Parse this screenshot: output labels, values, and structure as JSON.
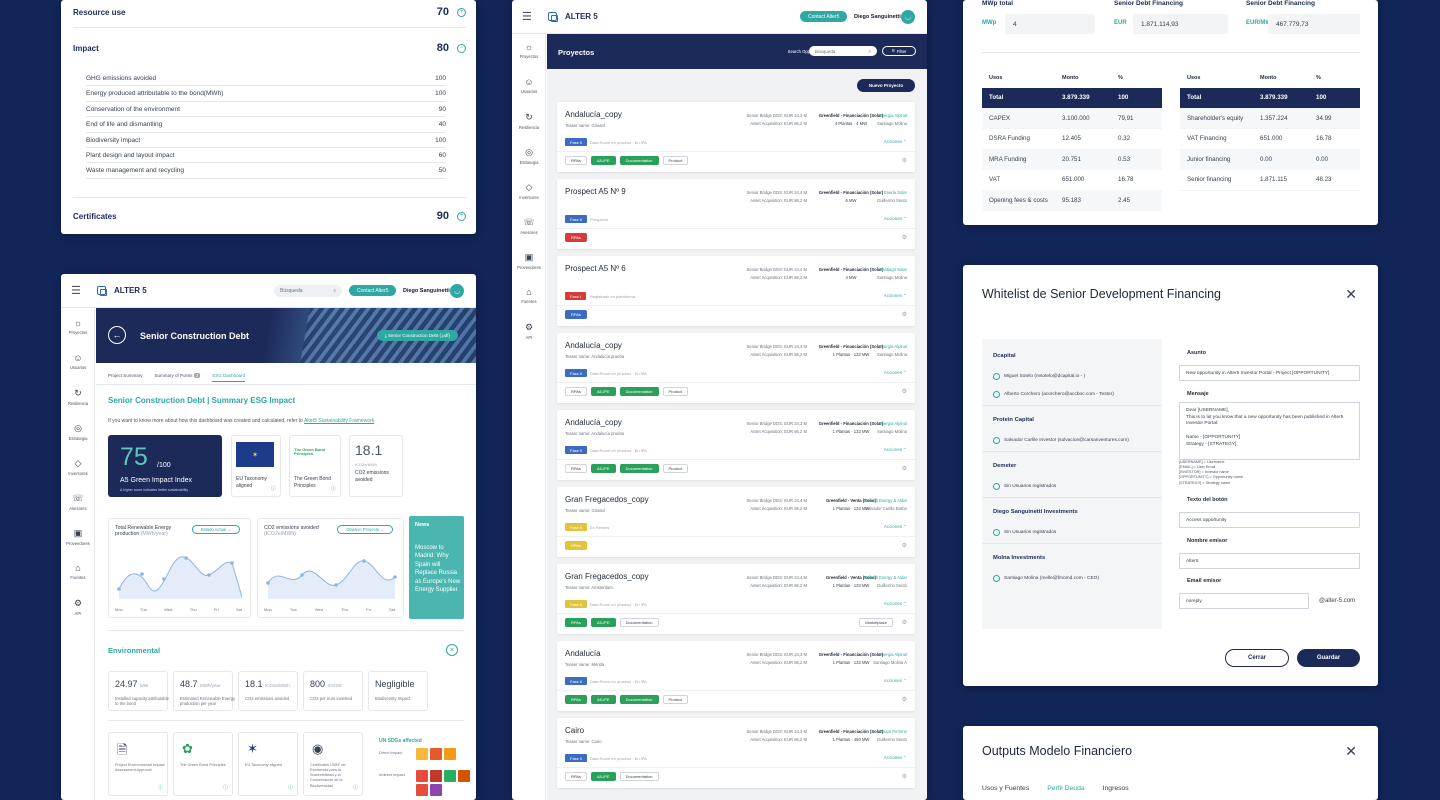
{
  "scores": {
    "resource_use": {
      "label": "Resource use",
      "value": "70"
    },
    "impact": {
      "label": "Impact",
      "value": "80"
    },
    "impact_items": [
      {
        "label": "GHG emissions avoided",
        "value": "100"
      },
      {
        "label": "Energy produced attributable to the bond(MWh)",
        "value": "100"
      },
      {
        "label": "Conservation of the environment",
        "value": "90"
      },
      {
        "label": "End of life and dismantling",
        "value": "40"
      },
      {
        "label": "Biodiversity impact",
        "value": "100"
      },
      {
        "label": "Plant design and layout impact",
        "value": "60"
      },
      {
        "label": "Waste management and recycling",
        "value": "50"
      }
    ],
    "certificates": {
      "label": "Certificates",
      "value": "90"
    }
  },
  "app": {
    "brand": "ALTER 5",
    "search_placeholder": "Búsqueda",
    "contact_label": "Contact Alter5",
    "user_name": "Diego Sanguinetti",
    "nav": [
      "Proyectos",
      "Usuarios",
      "Resiliencia",
      "Estrategia",
      "Inversores",
      "Asesores",
      "Proveedores",
      "Fuentes",
      "API"
    ]
  },
  "dashboard": {
    "hero_title": "Senior Construction Debt",
    "hero_pill": "Senior Construction Debt (.pdf)",
    "tabs": [
      "Project Summary",
      "Summary of Points",
      "ESG Dashboard"
    ],
    "tab_badge": "3",
    "title": "Senior Construction Debt | Summary ESG Impact",
    "intro": "If you want to know more about how this dashboard was created and calculated, refer to",
    "intro_link": "Alter5 Sustainability Framework",
    "index_value": "75",
    "index_max": "/100",
    "index_label": "A5 Green Impact Index",
    "index_note": "A higher score indicates better sustainability",
    "k2_label": "EU Taxonomy aligned",
    "k3_label": "The Green Bond Principles",
    "k3_logo": "The Green Bond Principles",
    "k4_value": "18.1",
    "k4_unit": "tCO2e/MWh",
    "k4_label": "CO2 emissions avoided",
    "chart1": {
      "title": "Total Renewable Energy production",
      "unit": "(MWh/year)",
      "select": "Estado Actual"
    },
    "chart2": {
      "title": "CO2 emissions avoided",
      "unit": "(tCO2e/MWh)",
      "select": "Objetivo Proyecto"
    },
    "days": [
      "Mon",
      "Tue",
      "Wed",
      "Thu",
      "Fri",
      "Sat"
    ],
    "news_title": "News",
    "news_text": "Moscow to Madrid: Why Spain will Replace Russia as Europe's New Energy Supplier",
    "env_title": "Environmental",
    "env": [
      {
        "value": "24.97",
        "unit": "MW",
        "label": "Installed capacity attributable to the bond"
      },
      {
        "value": "48.7",
        "unit": "MWh/year",
        "label": "Estimated Renewable Energy production per year"
      },
      {
        "value": "18.1",
        "unit": "tCO2e/MWh",
        "label": "CO2 emissions avoided"
      },
      {
        "value": "800",
        "unit": "tCO2/€",
        "label": "CO2 per euro invested"
      },
      {
        "value": "Negligible",
        "unit": "",
        "label": "Biodiversity Impact"
      }
    ],
    "docs": [
      "Project Environmental Impact Assessment Approval",
      "The Green Bond Principles",
      "EU Taxonomy aligned",
      "Certificates UNEF de Excelencia para la Sostenibilidad y la Conservación de la Biodiversidad"
    ],
    "sdg_title": "UN SDGs affected",
    "sdg_direct": "Direct impact",
    "sdg_indirect": "Indirect impact"
  },
  "projects_page": {
    "title": "Proyectos",
    "search_label": "Search Opportunities",
    "search_placeholder": "Búsqueda",
    "filter_label": "Filter",
    "new_label": "Nuevo Proyecto",
    "actions_label": "Acciones",
    "projects": [
      {
        "name": "Andalucía_copy",
        "sub": "Teaser name: Girasol",
        "m1a": "Senior Bridge DDS: EUR 24,3 M",
        "m1b": "Asset Acquisition: EUR 86,2 M",
        "m2a": "Greenfield - Financiación (Solar)",
        "m2b": "4 Plantas · 4 MW",
        "tag": "Energía Alpinal",
        "owner": "Santiago Molina",
        "phase": "Fase II",
        "phase_color": "blue",
        "note": "Data Room en proceso · En IPA",
        "chips": [
          [
            "RPAs",
            ""
          ],
          [
            "A5-IPE",
            "green"
          ],
          [
            "Documentation",
            "green"
          ],
          [
            "Product",
            ""
          ]
        ]
      },
      {
        "name": "Prospect A5 Nº 9",
        "sub": "",
        "m1a": "Senior Bridge DDS: EUR 24,4 M",
        "m1b": "Asset Acquisition: EUR 86,2 M",
        "m2a": "Greenfield - Financiación (Solar)",
        "m2b": "6 MW",
        "tag": "Enerla Solar",
        "owner": "Guillermo Seuto",
        "phase": "Fase II",
        "phase_color": "blue",
        "note": "Prospecto",
        "chips": [
          [
            "RPAs",
            "red"
          ]
        ]
      },
      {
        "name": "Prospect A5 Nº 6",
        "sub": "",
        "m1a": "Senior Bridge DDS: EUR 24,4 M",
        "m1b": "Asset Acquisition: EUR 86,2 M",
        "m2a": "Greenfield - Financiación (Solar)",
        "m2b": "4 MW",
        "tag": "Santiago Solar",
        "owner": "Santiago Molina",
        "phase": "Fase I",
        "phase_color": "red",
        "note": "Registrado en plataforma",
        "chips": [
          [
            "RPAs",
            "blue"
          ]
        ]
      },
      {
        "name": "Andalucía_copy",
        "sub": "Teaser name: Andalucía prueba",
        "m1a": "Senior Bridge DDS: EUR 24,3 M",
        "m1b": "Asset Acquisition: EUR 86,2 M",
        "m2a": "Greenfield - Financiación (Solar)",
        "m2b": "1 Plantas · 133 MW",
        "tag": "Energía Alpinal",
        "owner": "Santiago Molina",
        "phase": "Fase II",
        "phase_color": "blue",
        "note": "Data Room en proceso · En IPA",
        "chips": [
          [
            "RPAs",
            ""
          ],
          [
            "A5-IPE",
            "green"
          ],
          [
            "Documentation",
            "green"
          ],
          [
            "Product",
            ""
          ]
        ]
      },
      {
        "name": "Andalucía_copy",
        "sub": "Teaser name: Andalucía prueba",
        "m1a": "Senior Bridge DDS: EUR 24,3 M",
        "m1b": "Asset Acquisition: EUR 86,2 M",
        "m2a": "Greenfield - Financiación (Solar)",
        "m2b": "1 Plantas · 133 MW",
        "tag": "Energía Alpinal",
        "owner": "Santiago Molina",
        "phase": "Fase II",
        "phase_color": "blue",
        "note": "Data Room en proceso · En IPA",
        "chips": [
          [
            "RPAs",
            ""
          ],
          [
            "A5-IPE",
            "green"
          ],
          [
            "Documentation",
            "green"
          ],
          [
            "Product",
            ""
          ]
        ]
      },
      {
        "name": "Gran Fregacedos_copy",
        "sub": "Teaser name: Girasol",
        "m1a": "Senior Bridge DDS: EUR 24,4 M",
        "m1b": "Asset Acquisition: EUR 86,2 M",
        "m2a": "Greenfield - Venta (Solar)",
        "m2b": "1 Plantas · 133 MW",
        "tag": "Fotovelt Energy & Aldar",
        "owner": "Salvador Carlile Barbo",
        "phase": "Fase II",
        "phase_color": "yellow",
        "note": "En Review",
        "chips": [
          [
            "RPAs",
            "yellow"
          ]
        ]
      },
      {
        "name": "Gran Fregacedos_copy",
        "sub": "Teaser name: Amsterdam",
        "m1a": "Senior Bridge DDS: EUR 24,4 M",
        "m1b": "Asset Acquisition: EUR 86,2 M",
        "m2a": "Greenfield - Venta (Solar)",
        "m2b": "1 Plantas · 133 MW",
        "tag": "Fotovelt Energy & Aldar",
        "owner": "Guillermo Seuto",
        "phase": "Fase II",
        "phase_color": "yellow",
        "note": "Data Room en proceso · En IPA",
        "chips": [
          [
            "RPAs",
            "green"
          ],
          [
            "A5-IPE",
            "green"
          ],
          [
            "Documentation",
            ""
          ]
        ],
        "market": "Marketplace"
      },
      {
        "name": "Andalucía",
        "sub": "Teaser name: Mérida",
        "m1a": "Senior Bridge DDS: EUR 24,3 M",
        "m1b": "Asset Acquisition: EUR 86,2 M",
        "m2a": "Greenfield - Financiación (Solar)",
        "m2b": "1 Plantas · 133 MW",
        "tag": "Energía Alpinal",
        "owner": "Santiago Molina A",
        "phase": "Fase II",
        "phase_color": "blue",
        "note": "Data Room en proceso · En IPA",
        "chips": [
          [
            "RPAs",
            "green"
          ],
          [
            "A5-IPE",
            "green"
          ],
          [
            "Documentation",
            "green"
          ],
          [
            "Product",
            ""
          ]
        ]
      },
      {
        "name": "Cairo",
        "sub": "Teaser name: Cairo",
        "m1a": "Senior Bridge DDS: EUR 24,3 M",
        "m1b": "Asset Acquisition: EUR 86,2 M",
        "m2a": "Greenfield - Financiación (Solar)",
        "m2b": "1 Plantas · 450 MW",
        "tag": "Grupo Pertone",
        "owner": "Guillermo Seuto",
        "phase": "Fase II",
        "phase_color": "blue",
        "note": "Data Room en proceso · En IPA",
        "chips": [
          [
            "RPAs",
            ""
          ],
          [
            "A5-IPE",
            "green"
          ],
          [
            "Documentation",
            ""
          ]
        ]
      }
    ]
  },
  "financing": {
    "h1": "MWp total",
    "h2": "Senior Debt Financing",
    "h3": "Senior Debt Financing",
    "l1": "MWp",
    "v1": "4",
    "l2": "EUR",
    "v2": "1.871.114,93",
    "l3": "EUR/MW",
    "v3": "467.779,73",
    "headers": [
      "Usos",
      "Monto",
      "%"
    ],
    "usos": [
      [
        "Total",
        "3.879.339",
        "100"
      ],
      [
        "CAPEX",
        "3.100.000",
        "79,91"
      ],
      [
        "DSRA Funding",
        "12.405",
        "0.32"
      ],
      [
        "MRA Funding",
        "20.751",
        "0.53"
      ],
      [
        "VAT",
        "651.000",
        "16.78"
      ],
      [
        "Opening fees & costs",
        "95.183",
        "2.45"
      ]
    ],
    "fuentes": [
      [
        "Total",
        "3.879.339",
        "100"
      ],
      [
        "Shareholder's equity",
        "1.357.224",
        "34.99"
      ],
      [
        "VAT Financing",
        "651.000",
        "16.78"
      ],
      [
        "Junior financing",
        "0.00",
        "0.00"
      ],
      [
        "Senior financing",
        "1.871.115",
        "48.23"
      ]
    ]
  },
  "whitelist": {
    "title": "Whitelist de Senior Development Financing",
    "groups": [
      {
        "name": "Dcapital",
        "items": [
          "Miguel Sotelo (msotelo@dcapital.io - )",
          "Alberto Corchero (acorchero@accboc.com - Tester)"
        ]
      },
      {
        "name": "Protein Capital",
        "items": [
          "Salvador Carlile Investor (sulvacion@carsanventures.com)"
        ]
      },
      {
        "name": "Demeter",
        "items": [
          "Sin Usuarios registrados"
        ]
      },
      {
        "name": "Diego Sanguinetti Investments",
        "items": [
          "Sin Usuarios registrados"
        ]
      },
      {
        "name": "Molna Investments",
        "items": [
          "Santiago Molina (melle@fmomd.com - CEO)"
        ]
      }
    ],
    "asunto_label": "Asunto",
    "asunto_value": "New opportunity in Alter5 Investor Portal - Project [OPPORTUNITY]",
    "mensaje_label": "Mensaje",
    "mensaje_value": "Dear [USERNAME],\nThis is to let you know that a new opportunity has been published in Alter5 Investor Portal:\n\nName - [OPPORTUNITY]\nStrategy - [STRATEGY]",
    "vars": "[USERNAME] = Username\n[EMAIL] = User Email\n[INVESTOR] = Investor name\n[OPPORTUNITY] = Opportunity name\n[STRATEGY] = Strategy name",
    "boton_label": "Texto del botón",
    "boton_value": "Access opportunity",
    "emisor_label": "Nombre emisor",
    "emisor_value": "Alter5",
    "email_label": "Email emisor",
    "email_value": "noreply",
    "email_domain": "@alter-5.com",
    "cancel_label": "Cerrar",
    "save_label": "Guardar"
  },
  "outputs": {
    "title": "Outputs Modelo Financiero",
    "tabs": [
      "Usos y Fuentes",
      "Perfil Deuda",
      "Ingresos"
    ]
  }
}
